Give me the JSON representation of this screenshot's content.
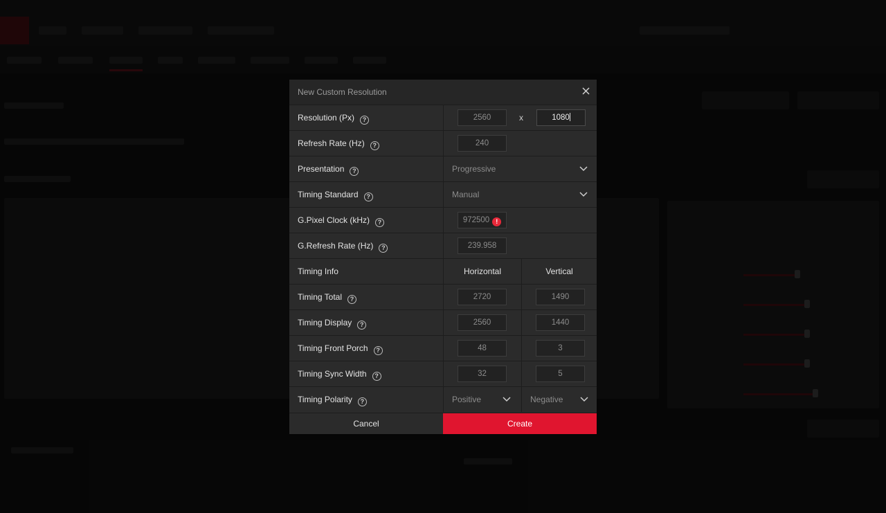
{
  "dialog": {
    "title": "New Custom Resolution",
    "close_icon": "close-icon",
    "rows": {
      "resolution": {
        "label": "Resolution (Px)",
        "width": "2560",
        "separator": "x",
        "height": "1080"
      },
      "refresh_rate": {
        "label": "Refresh Rate (Hz)",
        "value": "240"
      },
      "presentation": {
        "label": "Presentation",
        "selected": "Progressive"
      },
      "timing_standard": {
        "label": "Timing Standard",
        "selected": "Manual"
      },
      "pixel_clock": {
        "label": "G.Pixel Clock (kHz)",
        "value": "972500",
        "warning": "!"
      },
      "g_refresh_rate": {
        "label": "G.Refresh Rate (Hz)",
        "value": "239.958"
      },
      "timing_info": {
        "label": "Timing Info",
        "horizontal": "Horizontal",
        "vertical": "Vertical"
      },
      "timing_total": {
        "label": "Timing Total",
        "horizontal": "2720",
        "vertical": "1490"
      },
      "timing_display": {
        "label": "Timing Display",
        "horizontal": "2560",
        "vertical": "1440"
      },
      "timing_front_porch": {
        "label": "Timing Front Porch",
        "horizontal": "48",
        "vertical": "3"
      },
      "timing_sync_width": {
        "label": "Timing Sync Width",
        "horizontal": "32",
        "vertical": "5"
      },
      "timing_polarity": {
        "label": "Timing Polarity",
        "horizontal": "Positive",
        "vertical": "Negative"
      }
    },
    "help_glyph": "?",
    "buttons": {
      "cancel": "Cancel",
      "create": "Create"
    }
  },
  "colors": {
    "accent": "#e0152f",
    "dialog_bg": "#2b2b2b",
    "warning": "#e8293a"
  }
}
